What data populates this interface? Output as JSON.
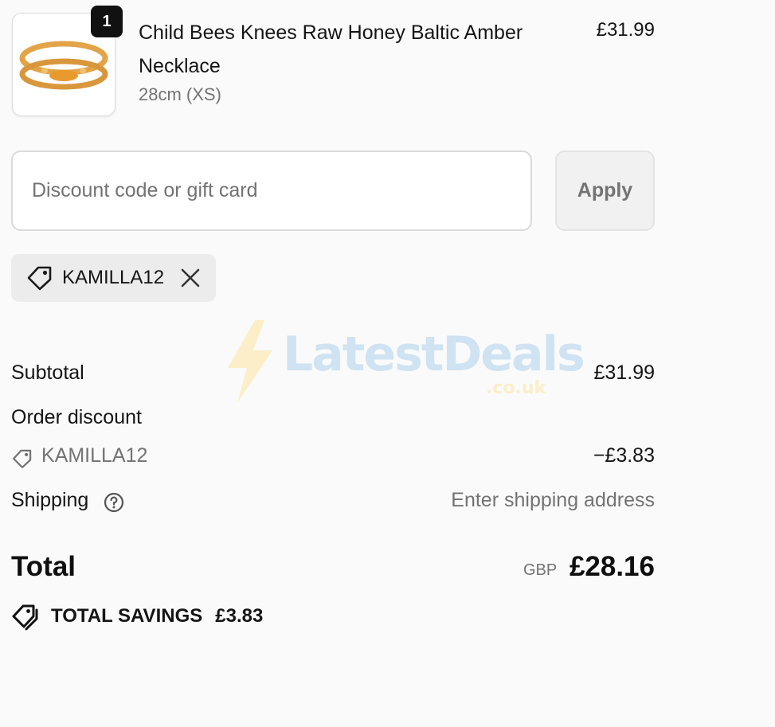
{
  "line_item": {
    "quantity": "1",
    "name": "Child Bees Knees Raw Honey Baltic Amber Necklace",
    "variant": "28cm (XS)",
    "price": "£31.99",
    "thumbnail_icon": "amber-necklace-image"
  },
  "discount": {
    "placeholder": "Discount code or gift card",
    "apply_label": "Apply",
    "applied_code": "KAMILLA12"
  },
  "summary": {
    "subtotal_label": "Subtotal",
    "subtotal_value": "£31.99",
    "order_discount_label": "Order discount",
    "discount_code": "KAMILLA12",
    "discount_value": "−£3.83",
    "shipping_label": "Shipping",
    "shipping_value": "Enter shipping address",
    "total_label": "Total",
    "currency": "GBP",
    "total_value": "£28.16",
    "savings_label": "TOTAL SAVINGS",
    "savings_value": "£3.83"
  },
  "watermark": {
    "brand": "LatestDeals",
    "domain": ".co.uk"
  },
  "colors": {
    "background": "#fafafa",
    "text": "#151515",
    "muted": "#737373",
    "chip": "#ececec"
  }
}
